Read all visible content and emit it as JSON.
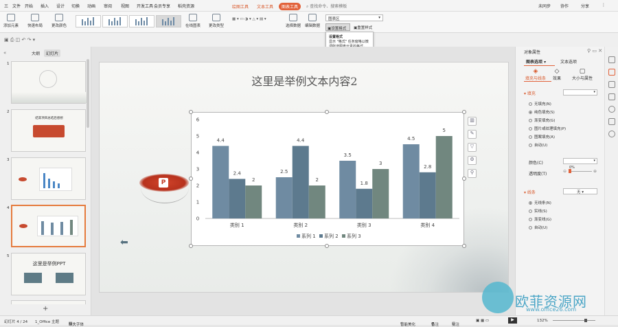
{
  "titlebar": {
    "menu": [
      "三",
      "文件",
      "开始",
      "插入",
      "设计",
      "切换",
      "动画",
      "审阅",
      "视图",
      "开发工具",
      "会员专享",
      "稻壳资源"
    ],
    "context_tabs": [
      "绘图工具",
      "文本工具",
      "图表工具"
    ],
    "search": "查找命令、搜索模板",
    "right": [
      "未同步",
      "协作",
      "分享"
    ]
  },
  "ribbon": {
    "buttons": [
      "添加元素",
      "快速布局",
      "更改颜色",
      "在线图表",
      "更改类型",
      "选择数据",
      "编辑数据"
    ],
    "element_select": "图表区",
    "set_format": "设置格式",
    "reset_style": "重置样式"
  },
  "tooltip": {
    "title": "设置格式",
    "body": "显示 \"格式\" 任务窗格以微调所选图表元素的格式。"
  },
  "left_panel": {
    "tabs": [
      "大纲",
      "幻灯片"
    ],
    "slides": [
      "1",
      "2",
      "3",
      "4",
      "5"
    ],
    "thumb2_title": "结束项目总结后感想",
    "thumb5_title": "这里是举例PPT",
    "add": "+"
  },
  "slide": {
    "title": "这里是举例文本内容2",
    "logo_text": "P"
  },
  "chart_data": {
    "type": "bar",
    "categories": [
      "类别 1",
      "类别 2",
      "类别 3",
      "类别 4"
    ],
    "series": [
      {
        "name": "系列 1",
        "values": [
          4.4,
          2.5,
          3.5,
          4.5
        ],
        "color": "#6f8ba2"
      },
      {
        "name": "系列 2",
        "values": [
          2.4,
          4.4,
          1.8,
          2.8
        ],
        "color": "#5d7a8e"
      },
      {
        "name": "系列 3",
        "values": [
          2,
          2,
          3,
          5
        ],
        "color": "#71877f"
      }
    ],
    "yticks": [
      "0",
      "1",
      "2",
      "3",
      "4",
      "5",
      "6"
    ],
    "ylim": [
      0,
      6
    ],
    "legend": "bottom",
    "grid": false
  },
  "right_panel": {
    "title": "对象属性",
    "dropdown": "图表选项",
    "text_options": "文本选项",
    "tabs": [
      "填充与线条",
      "效果",
      "大小与属性"
    ],
    "fill_header": "填充",
    "fill_options": [
      "无填充(N)",
      "纯色填充(S)",
      "渐变填充(G)",
      "图片或纹理填充(P)",
      "图案填充(A)",
      "自动(U)"
    ],
    "color_label": "颜色(C)",
    "transparency_label": "透明度(T)",
    "transparency_value": "0%",
    "line_header": "线条",
    "line_value": "无",
    "line_options": [
      "无线条(N)",
      "实线(S)",
      "渐变线(G)",
      "自动(U)"
    ]
  },
  "status": {
    "slide": "幻灯片 4 / 24",
    "theme": "1_Office 主题",
    "font": "缺失字体",
    "smart": "智能美化",
    "notes": "备注",
    "comment": "批注",
    "zoom": "132%"
  },
  "watermark": {
    "cn": "欧菲资源网",
    "url": "www.office26.com"
  }
}
